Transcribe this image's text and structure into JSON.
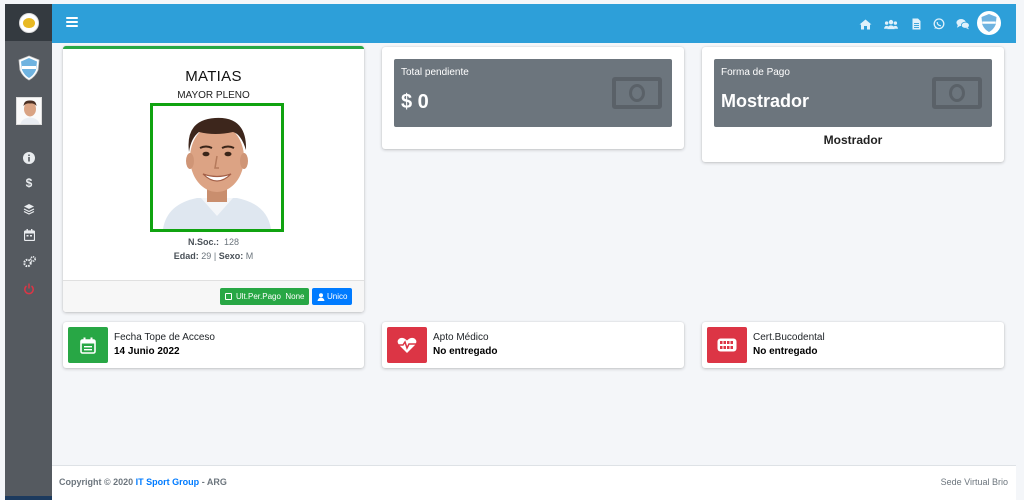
{
  "header": {
    "icons": [
      "home-icon",
      "users-icon",
      "document-icon",
      "whatsapp-icon",
      "chat-icon",
      "club-avatar-icon"
    ]
  },
  "sidebar": {
    "items": [
      "info-icon",
      "dollar-icon",
      "layers-icon",
      "calendar-icon",
      "cogs-icon",
      "power-icon"
    ]
  },
  "profile": {
    "name": "MATIAS",
    "category": "MAYOR PLENO",
    "socio_label": "N.Soc.:",
    "socio_number": "128",
    "age_label": "Edad:",
    "age": "29",
    "separator": "|",
    "sex_label": "Sexo:",
    "sex": "M",
    "last_payment_button": "Ult.Per.Pago  None",
    "plan_button": "Unico"
  },
  "pending": {
    "label": "Total pendiente",
    "amount": "$ 0"
  },
  "payment": {
    "label": "Forma de Pago",
    "value": "Mostrador",
    "caption": "Mostrador"
  },
  "stats": [
    {
      "label": "Fecha Tope de Acceso",
      "value": "14 Junio 2022"
    },
    {
      "label": "Apto Médico",
      "value": "No entregado"
    },
    {
      "label": "Cert.Bucodental",
      "value": "No entregado"
    }
  ],
  "footer": {
    "copyright": "Copyright © 2020",
    "company": "IT Sport Group",
    "suffix": "- ARG",
    "site": "Sede Virtual Brio"
  },
  "colors": {
    "topbar": "#2d9fd9",
    "sidebar": "#555a60",
    "success": "#28a745",
    "danger": "#dc3545",
    "primary": "#007bff",
    "box": "#6c757d"
  }
}
